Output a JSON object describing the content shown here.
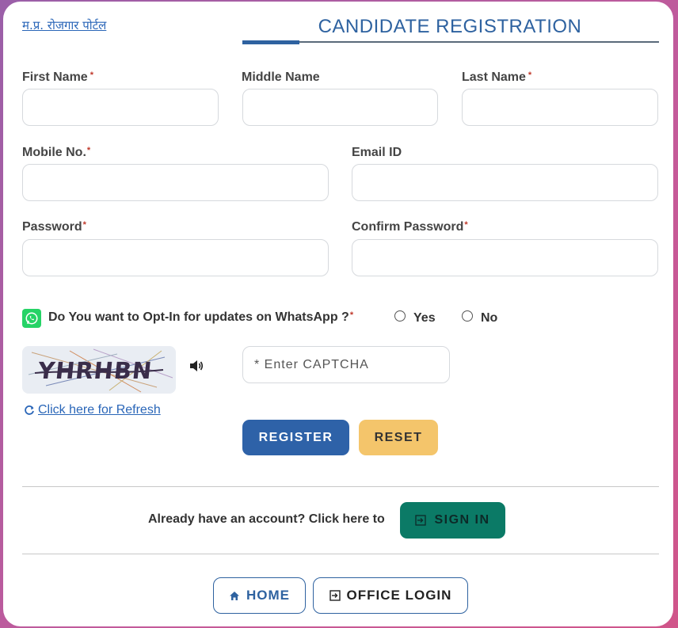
{
  "header": {
    "portal_link": "म.प्र. रोजगार पोर्टल",
    "title": "CANDIDATE REGISTRATION"
  },
  "form": {
    "first_name_label": "First Name",
    "middle_name_label": "Middle Name",
    "last_name_label": "Last Name",
    "mobile_label": "Mobile No.",
    "email_label": "Email ID",
    "password_label": "Password",
    "confirm_password_label": "Confirm Password",
    "required_mark": "*",
    "first_name_value": "",
    "middle_name_value": "",
    "last_name_value": "",
    "mobile_value": "",
    "email_value": "",
    "password_value": "",
    "confirm_password_value": ""
  },
  "whatsapp": {
    "question": "Do You want to Opt-In for updates on WhatsApp ?",
    "required_mark": "*",
    "options": [
      "Yes",
      "No"
    ]
  },
  "captcha": {
    "image_text": "YHRHBN",
    "input_placeholder": "* Enter CAPTCHA",
    "refresh_label": "Click here for Refresh"
  },
  "actions": {
    "register_label": "REGISTER",
    "reset_label": "RESET"
  },
  "signin": {
    "prompt": "Already have an account? Click here to",
    "button_label": "SIGN IN"
  },
  "footer": {
    "home_label": "HOME",
    "office_login_label": "OFFICE LOGIN"
  },
  "colors": {
    "primary": "#2e62a8",
    "accent_yellow": "#f4c56b",
    "signin_green": "#0b7a66",
    "whatsapp_green": "#25d366",
    "required_red": "#c0392b"
  },
  "icons": [
    "whatsapp-icon",
    "speaker-icon",
    "refresh-icon",
    "sign-in-icon",
    "home-icon",
    "office-login-icon"
  ]
}
